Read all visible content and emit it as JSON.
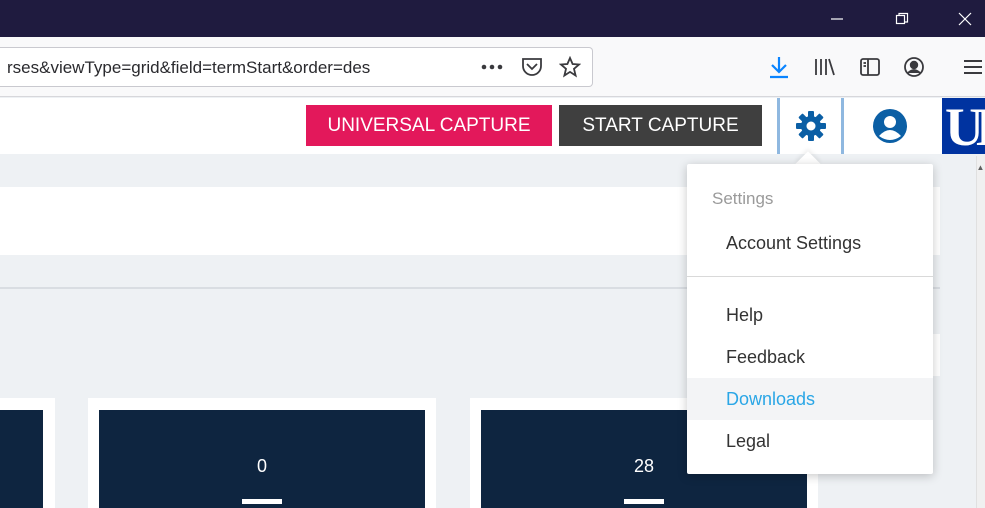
{
  "browser": {
    "url_visible": "rses&viewType=grid&field=termStart&order=des",
    "window_controls": [
      "minimize-icon",
      "restore-icon",
      "close-icon"
    ],
    "toolbar_icons": [
      "page-actions-icon",
      "pocket-icon",
      "bookmark-star-icon",
      "downloads-icon",
      "library-icon",
      "sidebar-icon",
      "account-icon",
      "menu-icon"
    ]
  },
  "header": {
    "universal_capture": "UNIVERSAL CAPTURE",
    "start_capture": "START CAPTURE",
    "logo_text": "UK",
    "colors": {
      "universal": "#e3185b",
      "start": "#3f3f3f",
      "icon_blue": "#0b5fa5",
      "logo_blue": "#0033a0"
    }
  },
  "settings_menu": {
    "heading": "Settings",
    "items": [
      {
        "label": "Account Settings"
      },
      {
        "label": "Help"
      },
      {
        "label": "Feedback"
      },
      {
        "label": "Downloads",
        "active": true
      },
      {
        "label": "Legal"
      }
    ],
    "active_color": "#2aa6e6"
  },
  "cards": [
    {
      "value": ""
    },
    {
      "value": "0"
    },
    {
      "value": "28"
    }
  ]
}
